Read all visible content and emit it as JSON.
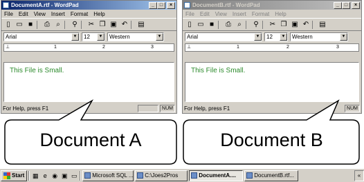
{
  "window_a": {
    "title": "DocumentA.rtf - WordPad",
    "menu": [
      "File",
      "Edit",
      "View",
      "Insert",
      "Format",
      "Help"
    ],
    "font": "Arial",
    "size": "12",
    "script": "Western",
    "ruler": [
      "1",
      "2",
      "3"
    ],
    "content": "This File is Small.",
    "status": "For Help, press F1",
    "num": "NUM"
  },
  "window_b": {
    "title": "DocumentB.rtf - WordPad",
    "menu": [
      "File",
      "Edit",
      "View",
      "Insert",
      "Format",
      "Help"
    ],
    "font": "Arial",
    "size": "12",
    "script": "Western",
    "ruler": [
      "1",
      "2",
      "3"
    ],
    "content": "This File is Small.",
    "status": "For Help, press F1",
    "num": "NUM"
  },
  "callouts": {
    "a": "Document A",
    "b": "Document B"
  },
  "taskbar": {
    "start": "Start",
    "tasks": [
      "Microsoft SQL ...",
      "C:\\Joes2Pros",
      "DocumentA....",
      "DocumentB.rtf..."
    ],
    "tray": "«"
  },
  "colors": {
    "content_text": "#2b8a2b",
    "titlebar_active": "#0a246a"
  }
}
